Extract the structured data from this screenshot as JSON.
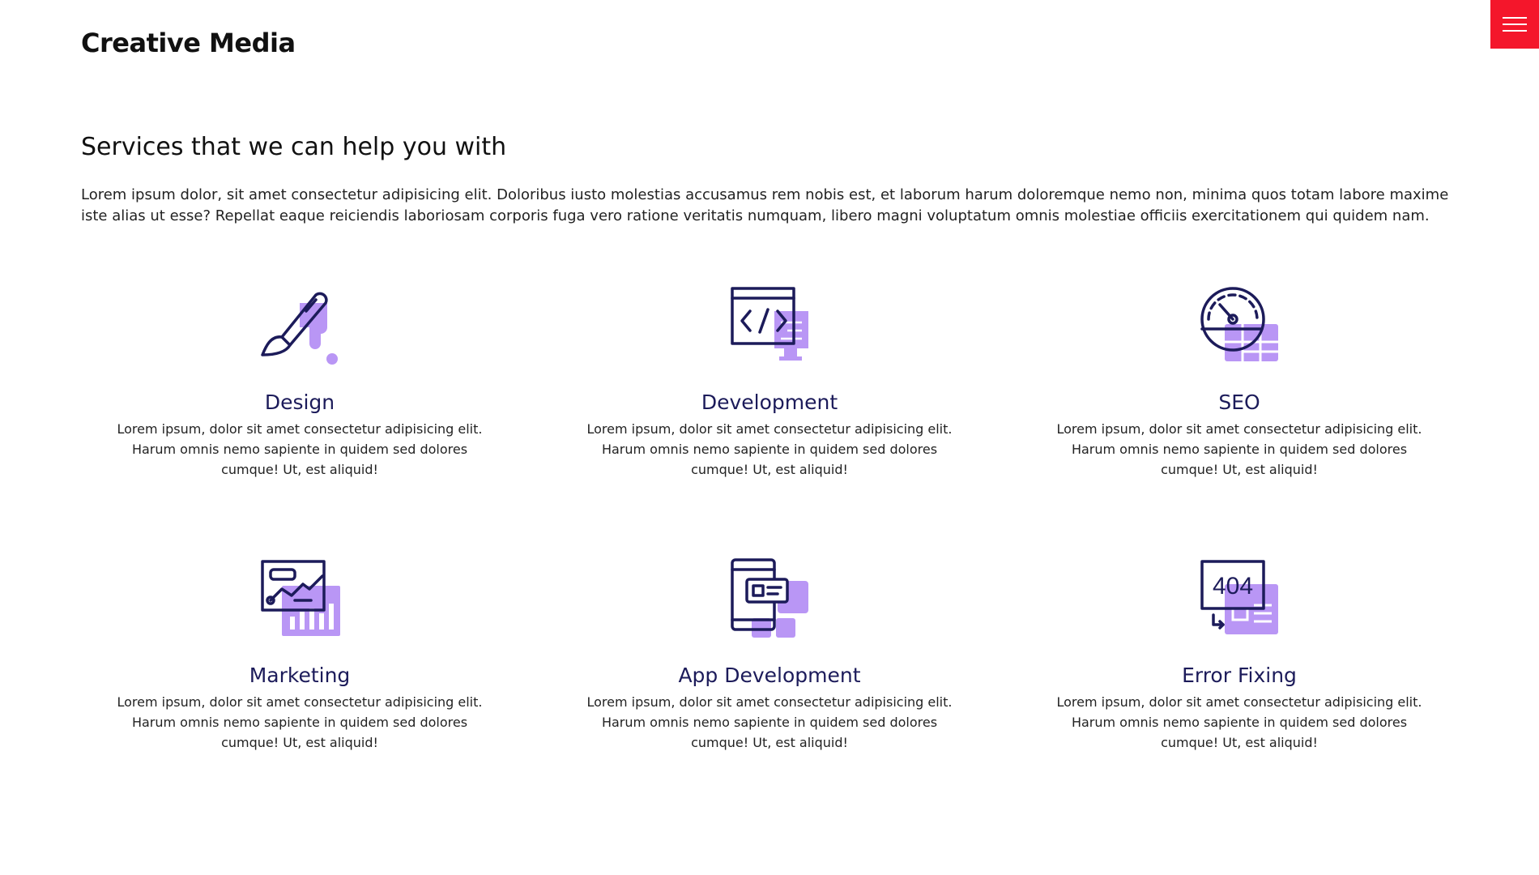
{
  "header": {
    "brand": "Creative Media"
  },
  "colors": {
    "accent": "#f4162b",
    "icon_primary": "#1c1b5a",
    "icon_secondary": "#b996f5"
  },
  "intro": {
    "title": "Services that we can help you with",
    "description": "Lorem ipsum dolor, sit amet consectetur adipisicing elit. Doloribus iusto molestias accusamus rem nobis est, et laborum harum doloremque nemo non, minima quos totam labore maxime iste alias ut esse? Repellat eaque reiciendis laboriosam corporis fuga vero ratione veritatis numquam, libero magni voluptatum omnis molestiae officiis exercitationem qui quidem nam."
  },
  "services": [
    {
      "icon": "paintbrush-icon",
      "title": "Design",
      "description": "Lorem ipsum, dolor sit amet consectetur adipisicing elit. Harum omnis nemo sapiente in quidem sed dolores cumque! Ut, est aliquid!"
    },
    {
      "icon": "code-monitor-icon",
      "title": "Development",
      "description": "Lorem ipsum, dolor sit amet consectetur adipisicing elit. Harum omnis nemo sapiente in quidem sed dolores cumque! Ut, est aliquid!"
    },
    {
      "icon": "gauge-icon",
      "title": "SEO",
      "description": "Lorem ipsum, dolor sit amet consectetur adipisicing elit. Harum omnis nemo sapiente in quidem sed dolores cumque! Ut, est aliquid!"
    },
    {
      "icon": "chart-icon",
      "title": "Marketing",
      "description": "Lorem ipsum, dolor sit amet consectetur adipisicing elit. Harum omnis nemo sapiente in quidem sed dolores cumque! Ut, est aliquid!"
    },
    {
      "icon": "mobile-app-icon",
      "title": "App Development",
      "description": "Lorem ipsum, dolor sit amet consectetur adipisicing elit. Harum omnis nemo sapiente in quidem sed dolores cumque! Ut, est aliquid!"
    },
    {
      "icon": "error-404-icon",
      "icon_text": "404",
      "title": "Error Fixing",
      "description": "Lorem ipsum, dolor sit amet consectetur adipisicing elit. Harum omnis nemo sapiente in quidem sed dolores cumque! Ut, est aliquid!"
    }
  ]
}
